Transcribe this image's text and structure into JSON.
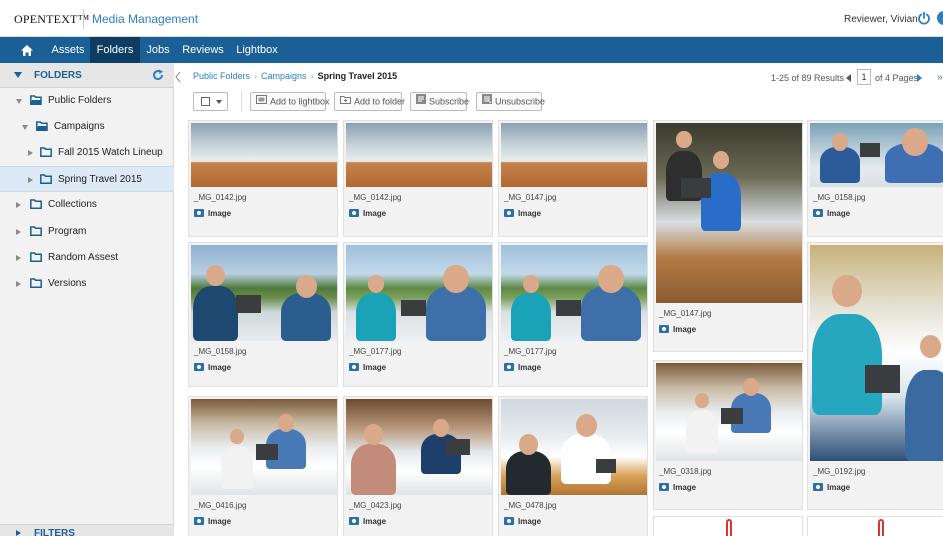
{
  "header": {
    "brand": "OPENTEXT™",
    "product": "Media Management",
    "user": "Reviewer, Vivian"
  },
  "nav": {
    "items": [
      {
        "label": "Assets"
      },
      {
        "label": "Folders"
      },
      {
        "label": "Jobs"
      },
      {
        "label": "Reviews"
      },
      {
        "label": "Lightbox"
      }
    ],
    "active": "Folders"
  },
  "sidebar": {
    "title": "FOLDERS",
    "tree": [
      {
        "label": "Public Folders",
        "level": 0,
        "expanded": true
      },
      {
        "label": "Campaigns",
        "level": 1,
        "expanded": true
      },
      {
        "label": "Fall 2015 Watch Lineup",
        "level": 2,
        "expanded": false
      },
      {
        "label": "Spring Travel 2015",
        "level": 2,
        "expanded": false,
        "selected": true
      },
      {
        "label": "Collections",
        "level": 0,
        "expanded": false
      },
      {
        "label": "Program",
        "level": 0,
        "expanded": false
      },
      {
        "label": "Random Assest",
        "level": 0,
        "expanded": false
      },
      {
        "label": "Versions",
        "level": 0,
        "expanded": false
      }
    ],
    "filters_label": "FILTERS"
  },
  "breadcrumb": {
    "items": [
      "Public Folders",
      "Campaigns"
    ],
    "current": "Spring Travel 2015"
  },
  "pager": {
    "results": "1-25 of 89 Results",
    "page": "1",
    "of_pages": "of 4 Pages"
  },
  "toolbar": {
    "add_lightbox": "Add to lightbox",
    "add_folder": "Add to folder",
    "subscribe": "Subscribe",
    "unsubscribe": "Unsubscribe"
  },
  "assets": [
    {
      "name": "_MG_0142.jpg",
      "type": "Image"
    },
    {
      "name": "_MG_0142.jpg",
      "type": "Image"
    },
    {
      "name": "_MG_0147.jpg",
      "type": "Image"
    },
    {
      "name": "_MG_0147.jpg",
      "type": "Image"
    },
    {
      "name": "_MG_0158.jpg",
      "type": "Image"
    },
    {
      "name": "_MG_0158.jpg",
      "type": "Image"
    },
    {
      "name": "_MG_0177.jpg",
      "type": "Image"
    },
    {
      "name": "_MG_0177.jpg",
      "type": "Image"
    },
    {
      "name": "_MG_0318.jpg",
      "type": "Image"
    },
    {
      "name": "_MG_0192.jpg",
      "type": "Image"
    },
    {
      "name": "_MG_0416.jpg",
      "type": "Image"
    },
    {
      "name": "_MG_0423.jpg",
      "type": "Image"
    },
    {
      "name": "_MG_0478.jpg",
      "type": "Image"
    }
  ],
  "colors": {
    "nav_bg": "#1a5f96",
    "nav_active": "#0d3d63",
    "accent": "#2b7fc2"
  }
}
